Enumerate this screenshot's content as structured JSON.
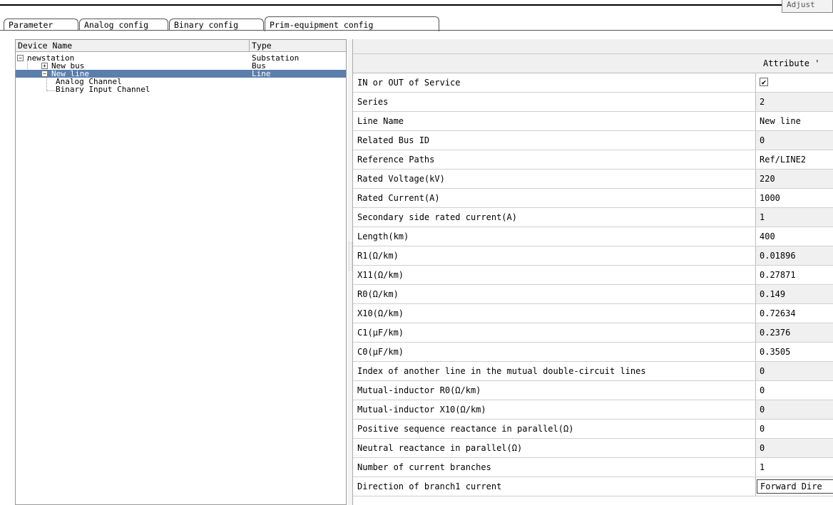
{
  "adjust_label": "Adjust",
  "tabs": [
    {
      "label": "Parameter"
    },
    {
      "label": "Analog config"
    },
    {
      "label": "Binary config"
    },
    {
      "label": "Prim-equipment config"
    }
  ],
  "tree": {
    "col_name": "Device Name",
    "col_type": "Type",
    "nodes": [
      {
        "name": "newstation",
        "type": "Substation",
        "expander": "−"
      },
      {
        "name": "New bus",
        "type": "Bus",
        "expander": "+"
      },
      {
        "name": "New line",
        "type": "Line",
        "expander": "−"
      },
      {
        "name": "Analog Channel",
        "type": ""
      },
      {
        "name": "Binary Input Channel",
        "type": ""
      }
    ]
  },
  "props": {
    "attr_header": "Attribute '",
    "rows": [
      {
        "name": "IN or OUT of Service",
        "value": "✔"
      },
      {
        "name": "Series",
        "value": "2"
      },
      {
        "name": "Line Name",
        "value": "New line"
      },
      {
        "name": "Related Bus ID",
        "value": "0"
      },
      {
        "name": "Reference Paths",
        "value": "Ref/LINE2"
      },
      {
        "name": "Rated Voltage(kV)",
        "value": "220"
      },
      {
        "name": "Rated Current(A)",
        "value": "1000"
      },
      {
        "name": "Secondary side rated current(A)",
        "value": "1"
      },
      {
        "name": "Length(km)",
        "value": "400"
      },
      {
        "name": "R1(Ω/km)",
        "value": "0.01896"
      },
      {
        "name": "X11(Ω/km)",
        "value": "0.27871"
      },
      {
        "name": "R0(Ω/km)",
        "value": "0.149"
      },
      {
        "name": "X10(Ω/km)",
        "value": "0.72634"
      },
      {
        "name": "C1(μF/km)",
        "value": "0.2376"
      },
      {
        "name": "C0(μF/km)",
        "value": "0.3505"
      },
      {
        "name": "Index of another line in the mutual double-circuit lines",
        "value": "0"
      },
      {
        "name": "Mutual-inductor R0(Ω/km)",
        "value": "0"
      },
      {
        "name": "Mutual-inductor X10(Ω/km)",
        "value": "0"
      },
      {
        "name": "Positive sequence reactance in parallel(Ω)",
        "value": "0"
      },
      {
        "name": "Neutral reactance in parallel(Ω)",
        "value": "0"
      },
      {
        "name": "Number of current branches",
        "value": "1"
      },
      {
        "name": "Direction of branch1 current",
        "value": "Forward Dire"
      }
    ]
  }
}
